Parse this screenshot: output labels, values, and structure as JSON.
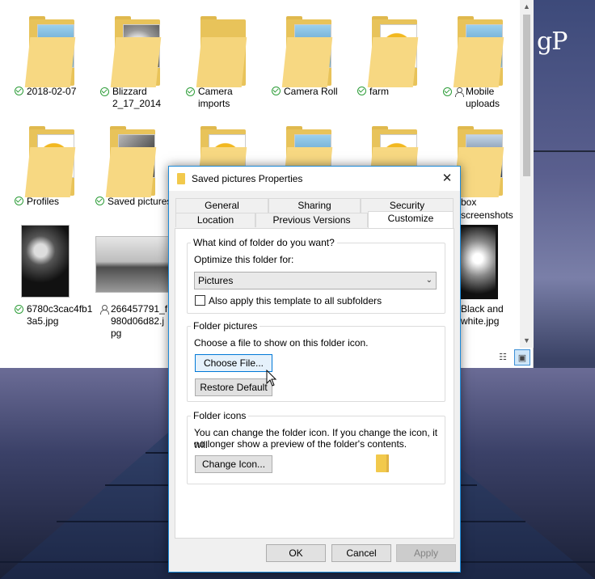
{
  "branding": {
    "logo_text": "gP"
  },
  "explorer": {
    "items": [
      {
        "label": "2018-02-07",
        "status": "synced"
      },
      {
        "label": "Blizzard 2_17_2014",
        "status": "synced"
      },
      {
        "label": "Camera imports",
        "status": "synced"
      },
      {
        "label": "Camera Roll",
        "status": "synced"
      },
      {
        "label": "farm",
        "status": "synced"
      },
      {
        "label": "Mobile uploads",
        "status": "synced-shared"
      },
      {
        "label": "Profiles",
        "status": "synced"
      },
      {
        "label": "Saved pictures",
        "status": "synced"
      },
      {
        "label": "box screenshots",
        "status": "none"
      },
      {
        "label": "6780c3cac4fb13a5.jpg",
        "label_line1": "6780c3cac4fb1",
        "label_line2": "3a5.jpg",
        "status": "synced"
      },
      {
        "label": "266457791_f980d06d82.jpg",
        "label_line1": "266457791_f",
        "label_line2": "980d06d82.j",
        "label_line3": "pg",
        "status": "shared"
      },
      {
        "label": "Black and white.jpg",
        "label_line1": "Black and",
        "label_line2": "white.jpg",
        "status": "none"
      }
    ],
    "view_icons": [
      "details-view-icon",
      "large-icons-view-icon"
    ]
  },
  "dialog": {
    "title": "Saved pictures Properties",
    "tabs_row1": [
      "General",
      "Sharing",
      "Security"
    ],
    "tabs_row2": [
      "Location",
      "Previous Versions",
      "Customize"
    ],
    "active_tab": "Customize",
    "folder_type": {
      "group_label": "What kind of folder do you want?",
      "optimize_label": "Optimize this folder for:",
      "selected": "Pictures",
      "subfolders_checkbox": "Also apply this template to all subfolders",
      "subfolders_checked": false
    },
    "folder_pictures": {
      "group_label": "Folder pictures",
      "description": "Choose a file to show on this folder icon.",
      "choose_file": "Choose File...",
      "restore_default": "Restore Default"
    },
    "folder_icons": {
      "group_label": "Folder icons",
      "description_line1": "You can change the folder icon. If you change the icon, it will",
      "description_line2": "no longer show a preview of the folder's contents.",
      "change_icon": "Change Icon..."
    },
    "buttons": {
      "ok": "OK",
      "cancel": "Cancel",
      "apply": "Apply"
    }
  },
  "colors": {
    "accent": "#0078d7",
    "sync_green": "#2e9d39",
    "folder_yellow": "#f7d882"
  }
}
